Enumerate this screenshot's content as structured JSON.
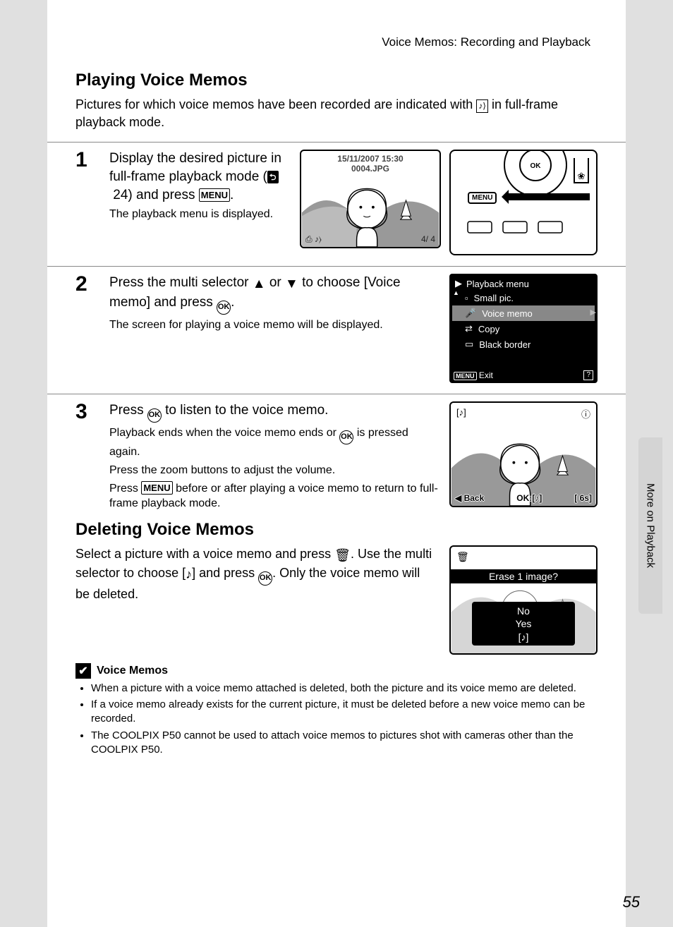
{
  "running_head": "Voice Memos: Recording and Playback",
  "section1": {
    "title": "Playing Voice Memos",
    "intro_a": "Pictures for which voice memos have been recorded are indicated with ",
    "intro_b": " in full-frame playback mode."
  },
  "step1": {
    "num": "1",
    "lead_a": "Display the desired picture in full-frame playback mode (",
    "lead_page": "24",
    "lead_b": ") and press ",
    "lead_c": ".",
    "sub": "The playback menu is displayed.",
    "lcd": {
      "date": "15/11/2007 15:30",
      "file": "0004.JPG",
      "counter_a": "4/",
      "counter_b": "4"
    },
    "camera_btn": "MENU"
  },
  "step2": {
    "num": "2",
    "lead_a": "Press the multi selector ",
    "lead_b": " or ",
    "lead_c": " to choose [Voice memo] and press ",
    "lead_d": ".",
    "sub": "The screen for playing a voice memo will be displayed.",
    "menu": {
      "title": "Playback menu",
      "items": [
        "Small pic.",
        "Voice memo",
        "Copy",
        "Black border"
      ],
      "exit": "Exit",
      "menu_label": "MENU",
      "help": "?"
    }
  },
  "step3": {
    "num": "3",
    "lead_a": "Press ",
    "lead_b": " to listen to the voice memo.",
    "sub1_a": "Playback ends when the voice memo ends or ",
    "sub1_b": " is pressed again.",
    "sub2": "Press the zoom buttons to adjust the volume.",
    "sub3_a": "Press ",
    "sub3_b": " before or after playing a voice memo to return to full-frame playback mode.",
    "lcd": {
      "back": "Back",
      "ok": "OK",
      "sep": ":",
      "time": "6s"
    }
  },
  "section2": {
    "title": "Deleting Voice Memos",
    "body_a": "Select a picture with a voice memo and press ",
    "body_b": ". Use the multi selector to choose [",
    "body_c": "] and press ",
    "body_d": ". Only the voice memo will be deleted.",
    "lcd": {
      "question": "Erase 1 image?",
      "no": "No",
      "yes": "Yes"
    }
  },
  "notes": {
    "head": "Voice Memos",
    "bullets": [
      "When a picture with a voice memo attached is deleted, both the picture and its voice memo are deleted.",
      "If a voice memo already exists for the current picture, it must be deleted before a new voice memo can be recorded.",
      "The COOLPIX P50 cannot be used to attach voice memos to pictures shot with cameras other than the COOLPIX P50."
    ]
  },
  "side_tab": "More on Playback",
  "page_num": "55"
}
